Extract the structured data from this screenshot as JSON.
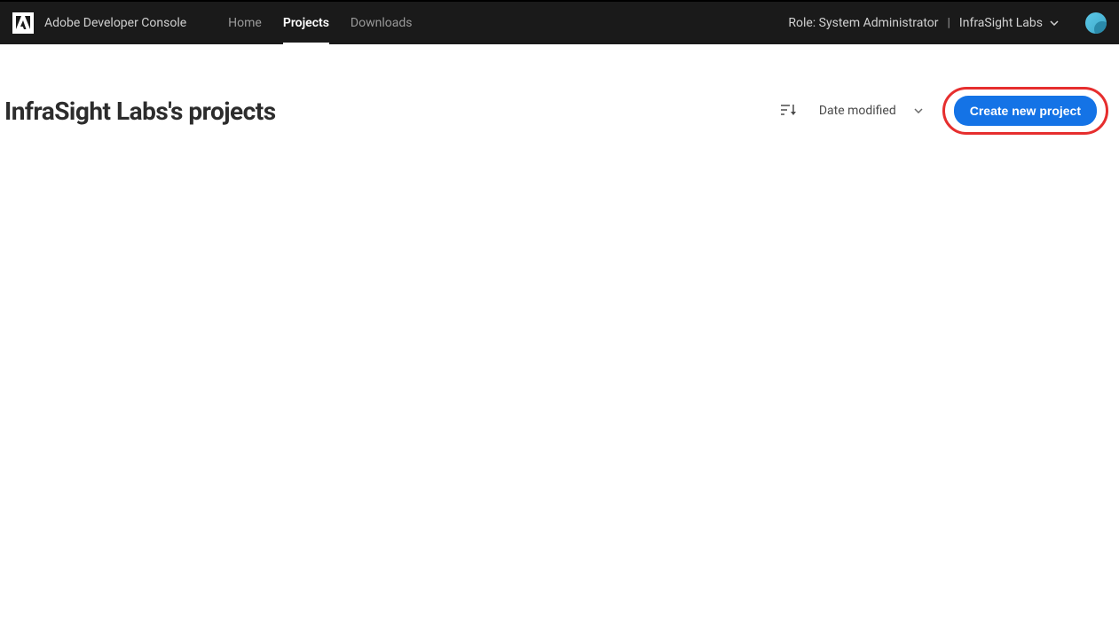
{
  "header": {
    "brand": "Adobe Developer Console",
    "nav": {
      "home": "Home",
      "projects": "Projects",
      "downloads": "Downloads"
    },
    "role_label": "Role: System Administrator",
    "org_name": "InfraSight Labs"
  },
  "main": {
    "title": "InfraSight Labs's projects",
    "sort_label": "Date modified",
    "create_button_label": "Create new project"
  },
  "colors": {
    "header_bg": "#1a1a1a",
    "accent_blue": "#1473e6",
    "highlight_red": "#e62e2e",
    "avatar": "#5cc8e8"
  }
}
